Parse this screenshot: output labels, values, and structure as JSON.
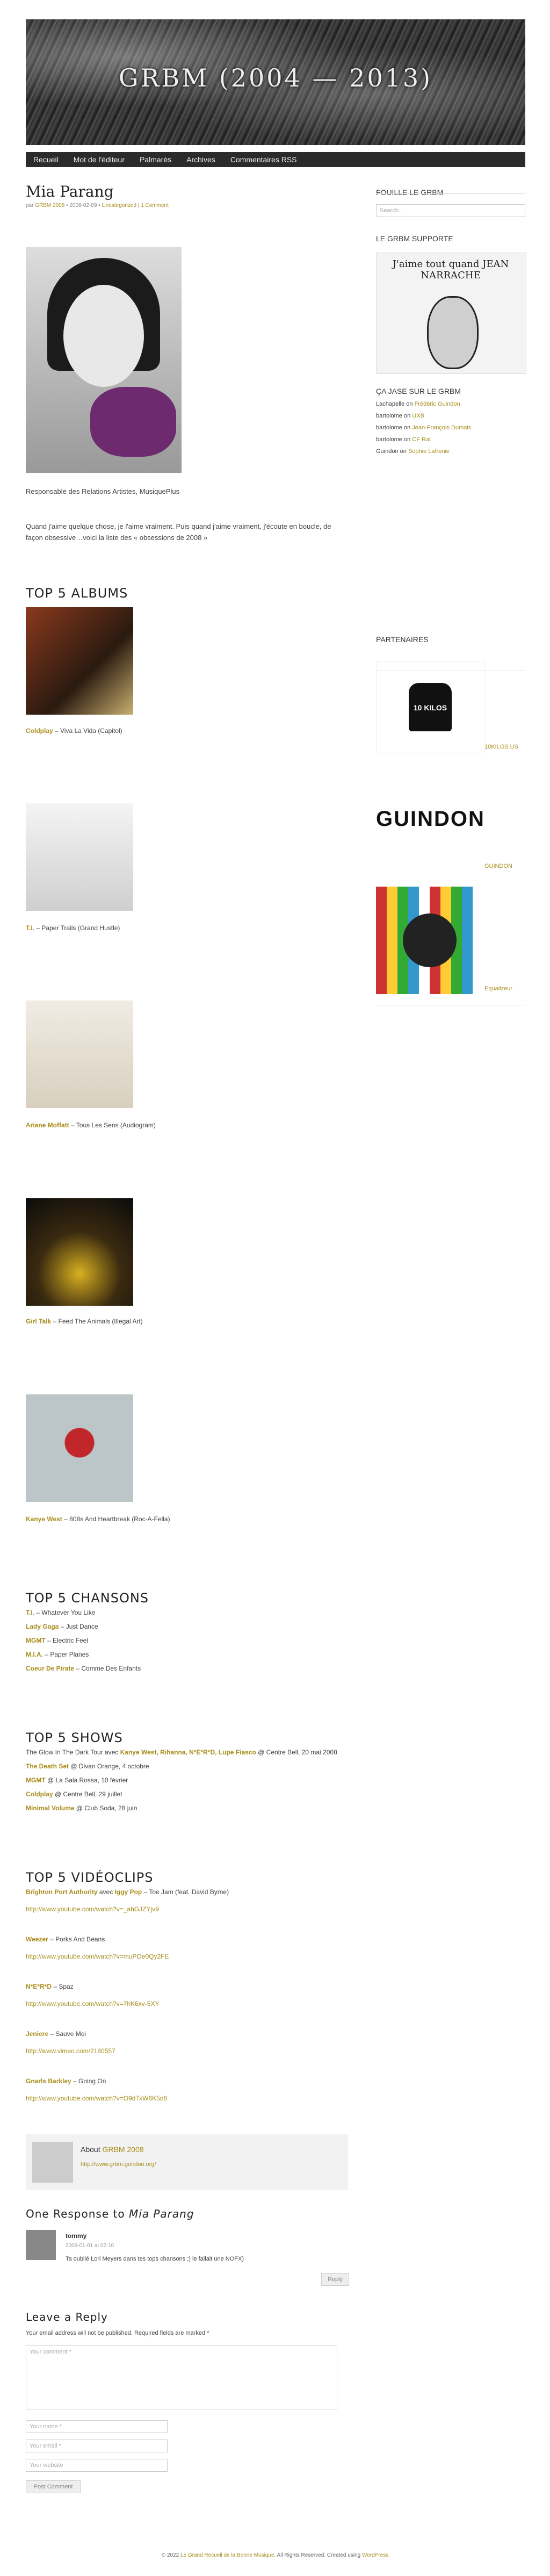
{
  "site": {
    "title": "GRBM (2004 — 2013)"
  },
  "nav": [
    "Recueil",
    "Mot de l'éditeur",
    "Palmarès",
    "Archives",
    "Commentaires RSS"
  ],
  "post": {
    "title": "Mia Parang",
    "meta": {
      "by": "par",
      "author": "GRBM 2008",
      "date": "2008-02-09",
      "category": "Uncategorized",
      "comments": "1 Comment"
    },
    "role": "Responsable des Relations Artistes, MusiquePlus",
    "quote": "Quand j'aime quelque chose, je l'aime vraiment. Puis quand j'aime vraiment, j'écoute en boucle, de façon obsessive…voici la liste des « obsessions de 2008 »",
    "albums_title": "TOP 5 ALBUMS",
    "albums": [
      {
        "artist": "Coldplay",
        "rest": " – Viva La Vida (Capitol)"
      },
      {
        "artist": "T.I.",
        "rest": " – Paper Trails (Grand Hustle)"
      },
      {
        "artist": "Ariane Moffatt",
        "rest": " – Tous Les Sens (Audiogram)"
      },
      {
        "artist": "Girl Talk",
        "rest": " – Feed The Animals (Illegal Art)"
      },
      {
        "artist": "Kanye West",
        "rest": " – 808s And Heartbreak (Roc-A-Fella)"
      }
    ],
    "songs_title": "TOP 5 CHANSONS",
    "songs": [
      {
        "artist": "T.I.",
        "rest": " – Whatever You Like"
      },
      {
        "artist": "Lady Gaga",
        "rest": " – Just Dance"
      },
      {
        "artist": "MGMT",
        "rest": " – Electric Feel"
      },
      {
        "artist": "M.I.A.",
        "rest": " – Paper Planes"
      },
      {
        "artist": "Coeur De Pirate",
        "rest": " – Comme Des Enfants"
      }
    ],
    "shows_title": "TOP 5 SHOWS",
    "shows": [
      {
        "pre": "The Glow In The Dark Tour avec ",
        "bold": "Kanye West, Rihanna, N*E*R*D, Lupe Fiasco",
        "rest": " @ Centre Bell, 20 mai 2008"
      },
      {
        "pre": "",
        "bold": "The Death Set",
        "rest": " @ Divan Orange, 4 octobre"
      },
      {
        "pre": "",
        "bold": "MGMT",
        "rest": " @ La Sala Rossa, 10 février"
      },
      {
        "pre": "",
        "bold": "Coldplay",
        "rest": " @ Centre Bell, 29 juillet"
      },
      {
        "pre": "",
        "bold": "Minimal Volume",
        "rest": " @ Club Soda, 28 juin"
      }
    ],
    "clips_title": "TOP 5 VIDÉOCLIPS",
    "clips": [
      {
        "line": "Brighton Port Authority avec Iggy Pop",
        "bold": "Brighton Port Authority",
        "mid": " avec ",
        "bold2": "Iggy Pop",
        "rest": " – Toe Jam (feat. David Byrne)",
        "url": "http://www.youtube.com/watch?v=_ahGJZYjv9"
      },
      {
        "bold": "Weezer",
        "mid": "",
        "bold2": "",
        "rest": " – Porks And Beans",
        "url": "http://www.youtube.com/watch?v=muPOe0Qy2FE"
      },
      {
        "bold": "N*E*R*D",
        "mid": "",
        "bold2": "",
        "rest": " – Spaz",
        "url": "http://www.youtube.com/watch?v=7hK6xv-5XY"
      },
      {
        "bold": "Jeniere",
        "mid": "",
        "bold2": "",
        "rest": " – Sauve Moi",
        "url": "http://www.vimeo.com/2180557"
      },
      {
        "bold": "Gnarls Barkley",
        "mid": "",
        "bold2": "",
        "rest": " – Going On",
        "url": "http://www.youtube.com/watch?v=O9d7xW6K5o8"
      }
    ]
  },
  "about": {
    "label": "About",
    "name": "GRBM 2008",
    "url": "http://www.grbm.gondon.org/"
  },
  "comments": {
    "title_pre": "One Response to ",
    "title_em": "Mia Parang",
    "items": [
      {
        "author": "tommy",
        "date": "2009-01-01 at 02:10",
        "text": "Ta oublié Lori Meyers dans tes tops chansons ;) le fallait une NOFX)",
        "reply": "Reply"
      }
    ]
  },
  "reply": {
    "title": "Leave a Reply",
    "note": "Your email address will not be published. Required fields are marked *",
    "comment_ph": "Your comment *",
    "name_ph": "Your name *",
    "email_ph": "Your email *",
    "website_ph": "Your website",
    "submit": "Post Comment"
  },
  "sidebar": {
    "search_title": "FOUILLE LE GRBM",
    "search_ph": "Search...",
    "support_title": "LE GRBM SUPPORTE",
    "support_text": "J'aime tout quand JEAN NARRACHE",
    "jase_title": "ÇA JASE SUR LE GRBM",
    "jase": [
      {
        "who": "Lachapelle",
        "on": " on ",
        "what": "Frédéric Guindon"
      },
      {
        "who": "bartolome",
        "on": " on ",
        "what": "UXB"
      },
      {
        "who": "bartolome",
        "on": " on ",
        "what": "Jean-François Dumais"
      },
      {
        "who": "bartolome",
        "on": " on ",
        "what": "CF Rat"
      },
      {
        "who": "Guindon",
        "on": " on ",
        "what": "Sophie Lafrenie"
      }
    ],
    "partners_title": "PARTENAIRES",
    "partners": [
      {
        "label": "10 KILOS",
        "link": "10KILOS.US"
      },
      {
        "label": "GUINDON",
        "link": "GUINDON"
      },
      {
        "label": "",
        "link": "Equalizeur"
      }
    ]
  },
  "footer": {
    "pre": "© 2022 ",
    "site": "Le Grand Recueil de la Bonne Musique",
    "mid": ". All Rights Reserved. Created using ",
    "tool": "WordPress"
  }
}
